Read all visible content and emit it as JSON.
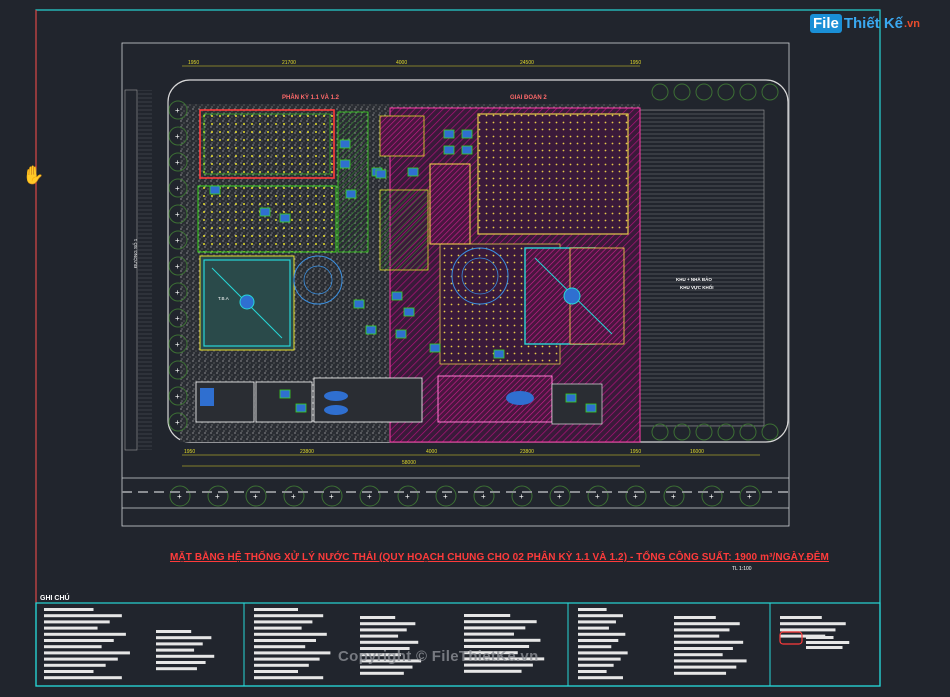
{
  "watermark": {
    "brand_file": "File",
    "brand_rest": "Thiết Kế",
    "brand_tld": ".vn"
  },
  "copyright": "Copyright © FileThietKe.vn",
  "drawing": {
    "title": "MẶT BẰNG HỆ THỐNG XỬ LÝ NƯỚC THẢI (QUY HOẠCH CHUNG CHO 02 PHÂN KỲ 1.1 VÀ 1.2) - TỔNG CÔNG SUẤT: 1900 m³/NGÀY.ĐÊM",
    "scale": "TL 1:100",
    "phase_tag_1": "PHÂN KỲ 1.1 VÀ 1.2",
    "phase_tag_2": "GIAI ĐOẠN 2",
    "notes_title": "GHI CHÚ",
    "right_area_label": "KHU + NHÀ BẢO",
    "right_area_sub": "KHU VỰC KHỐI",
    "tank_label": "T.B.A",
    "road_label": "ĐƯỜNG SỐ 1",
    "dims_top": [
      "1950",
      "21700",
      "4000",
      "24500",
      "1950"
    ],
    "dims_bottom": [
      "1950",
      "23800",
      "4000",
      "23800",
      "1950",
      "16000"
    ],
    "dim_total": "58000"
  },
  "colors": {
    "background": "#21252d",
    "frame": "#27d6d6",
    "title": "#ff3b3b",
    "phase2_hatch": "#b0127a",
    "green": "#39d61e",
    "yellow": "#e5dc28"
  }
}
